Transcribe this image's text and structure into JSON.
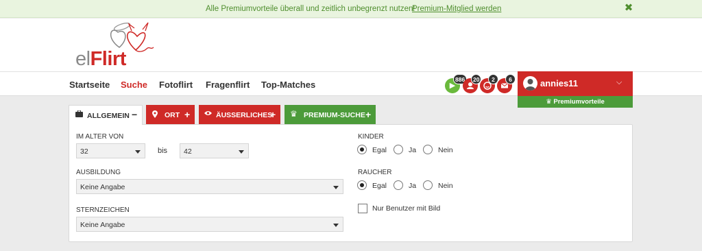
{
  "promo": {
    "text": "Alle Premiumvorteile überall und zeitlich unbegrenzt nutzen!",
    "link": "Premium-Mitglied werden",
    "close_glyph": "✖"
  },
  "logo": {
    "el": "el",
    "flirt": "Flirt"
  },
  "nav": {
    "items": [
      {
        "label": "Startseite"
      },
      {
        "label": "Suche"
      },
      {
        "label": "Fotoflirt"
      },
      {
        "label": "Fragenflirt"
      },
      {
        "label": "Top-Matches"
      }
    ],
    "active": "Suche"
  },
  "badges": [
    {
      "icon": "play-icon",
      "count": "886",
      "color": "#6ab93c"
    },
    {
      "icon": "user-icon",
      "count": "20",
      "color": "#cf2a27"
    },
    {
      "icon": "smiley-icon",
      "count": "2",
      "color": "#cf2a27"
    },
    {
      "icon": "mail-icon",
      "count": "6",
      "color": "#cf2a27"
    }
  ],
  "user": {
    "name": "annies11",
    "premium_label": "Premiumvorteile"
  },
  "tabs": [
    {
      "label": "ALLGEMEIN",
      "action": "−",
      "icon": "briefcase-icon"
    },
    {
      "label": "ORT",
      "action": "+",
      "icon": "location-pin-icon"
    },
    {
      "label": "ÄUSSERLICHES",
      "action": "+",
      "icon": "eye-icon"
    },
    {
      "label": "PREMIUM-SUCHE",
      "action": "+",
      "icon": "crown-icon"
    }
  ],
  "form": {
    "age": {
      "label": "IM ALTER VON",
      "from": "32",
      "to_label": "bis",
      "to": "42"
    },
    "ausbildung": {
      "label": "AUSBILDUNG",
      "value": "Keine Angabe"
    },
    "sternzeichen": {
      "label": "STERNZEICHEN",
      "value": "Keine Angabe"
    },
    "kinder": {
      "label": "KINDER",
      "options": [
        "Egal",
        "Ja",
        "Nein"
      ],
      "selected": "Egal"
    },
    "raucher": {
      "label": "RAUCHER",
      "options": [
        "Egal",
        "Ja",
        "Nein"
      ],
      "selected": "Egal"
    },
    "nur_bild": {
      "label": "Nur Benutzer mit Bild",
      "checked": false
    }
  },
  "colors": {
    "brand_red": "#cf2a27",
    "brand_green": "#4c9b3a",
    "promo_text": "#4f8e2e"
  }
}
